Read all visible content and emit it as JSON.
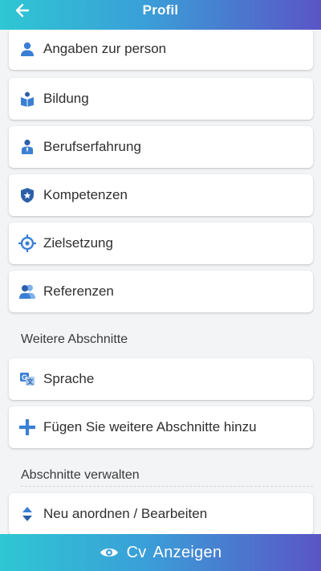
{
  "header": {
    "title": "Profil",
    "back_icon": "arrow-left-icon"
  },
  "sections": {
    "main_items": [
      {
        "label": "Angaben zur person",
        "icon": "person-icon"
      },
      {
        "label": "Bildung",
        "icon": "book-reader-icon"
      },
      {
        "label": "Berufserfahrung",
        "icon": "worker-tie-icon"
      },
      {
        "label": "Kompetenzen",
        "icon": "shield-star-icon"
      },
      {
        "label": "Zielsetzung",
        "icon": "target-icon"
      },
      {
        "label": "Referenzen",
        "icon": "users-icon"
      }
    ],
    "more_title": "Weitere Abschnitte",
    "more_items": [
      {
        "label": "Sprache",
        "icon": "translate-icon"
      },
      {
        "label": "Fügen Sie weitere Abschnitte hinzu",
        "icon": "plus-icon"
      }
    ],
    "manage_title": "Abschnitte verwalten",
    "manage_items": [
      {
        "label": "Neu anordnen / Bearbeiten",
        "icon": "sort-icon"
      }
    ]
  },
  "footer": {
    "button_word1": "Cv",
    "button_word2": "Anzeigen",
    "icon": "eye-icon"
  },
  "colors": {
    "gradient_start": "#2ec7d3",
    "gradient_end": "#5a55c6",
    "icon_blue": "#3a7fd4",
    "background": "#f3f4f6"
  }
}
